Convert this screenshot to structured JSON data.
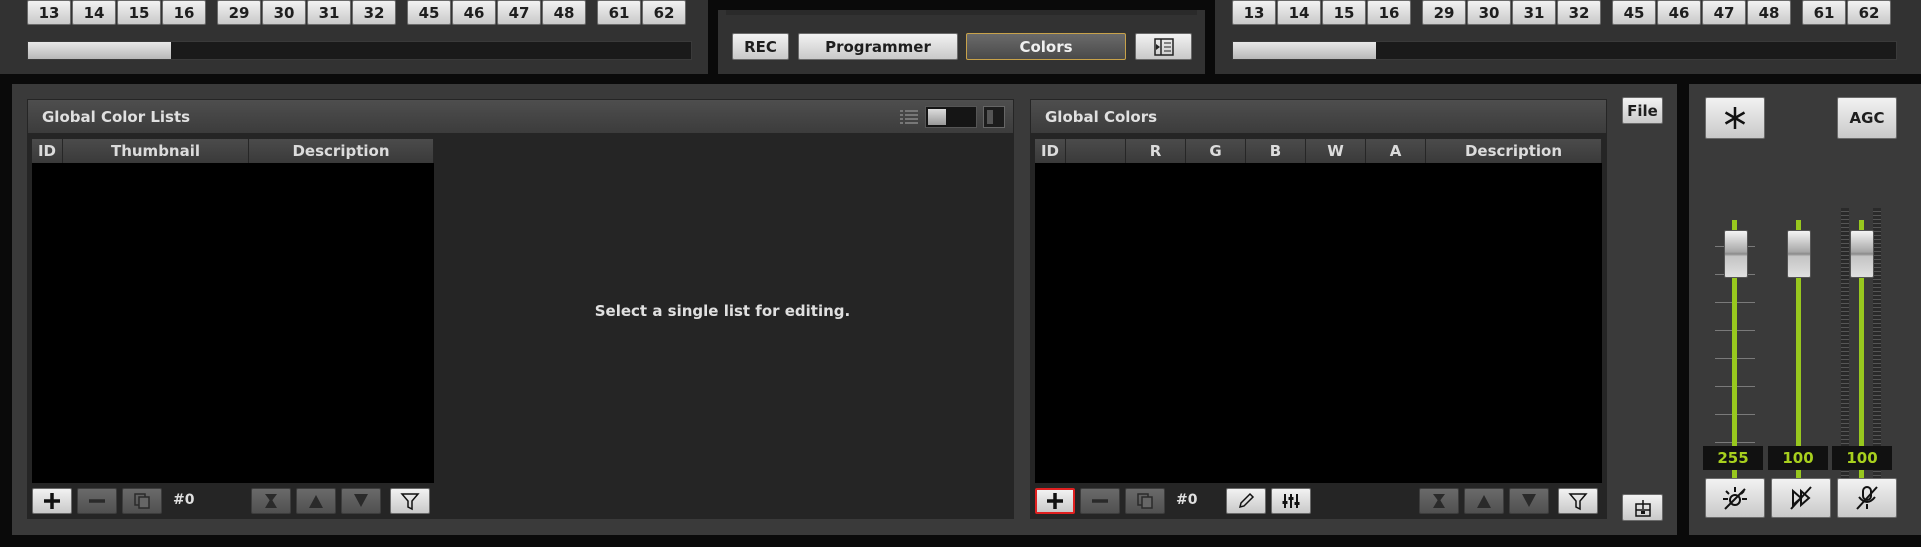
{
  "top_left_group": {
    "numbers": [
      [
        "13",
        "14",
        "15",
        "16"
      ],
      [
        "29",
        "30",
        "31",
        "32"
      ],
      [
        "45",
        "46",
        "47",
        "48"
      ],
      [
        "61",
        "62"
      ]
    ],
    "scroll_position": 0.2
  },
  "top_right_group": {
    "numbers": [
      [
        "13",
        "14",
        "15",
        "16"
      ],
      [
        "29",
        "30",
        "31",
        "32"
      ],
      [
        "45",
        "46",
        "47",
        "48"
      ],
      [
        "61",
        "62"
      ]
    ],
    "scroll_position": 0.2
  },
  "mode_bar": {
    "rec_label": "REC",
    "programmer_label": "Programmer",
    "colors_label": "Colors",
    "active_mode": "Colors"
  },
  "global_color_lists": {
    "title": "Global Color Lists",
    "columns": [
      "ID",
      "Thumbnail",
      "Description"
    ],
    "rows": [],
    "empty_message": "Select a single list for editing.",
    "count_label": "#0"
  },
  "global_colors": {
    "title": "Global Colors",
    "columns": [
      "ID",
      "",
      "R",
      "G",
      "B",
      "W",
      "A",
      "Description"
    ],
    "rows": [],
    "count_label": "#0"
  },
  "side": {
    "file_label": "File"
  },
  "faders": {
    "agc_label": "AGC",
    "values": [
      "255",
      "100",
      "100"
    ],
    "levels": [
      1.0,
      1.0,
      1.0
    ]
  },
  "icons": {
    "freeze": "snowflake-icon",
    "add": "plus-icon",
    "remove": "minus-icon",
    "duplicate": "duplicate-icon",
    "edit": "pencil-icon",
    "mixer": "sliders-icon",
    "filter": "filter-icon"
  },
  "colors": {
    "accent_level": "#98c81e",
    "active_border": "#c8a24a",
    "add_highlight": "#e02020"
  }
}
